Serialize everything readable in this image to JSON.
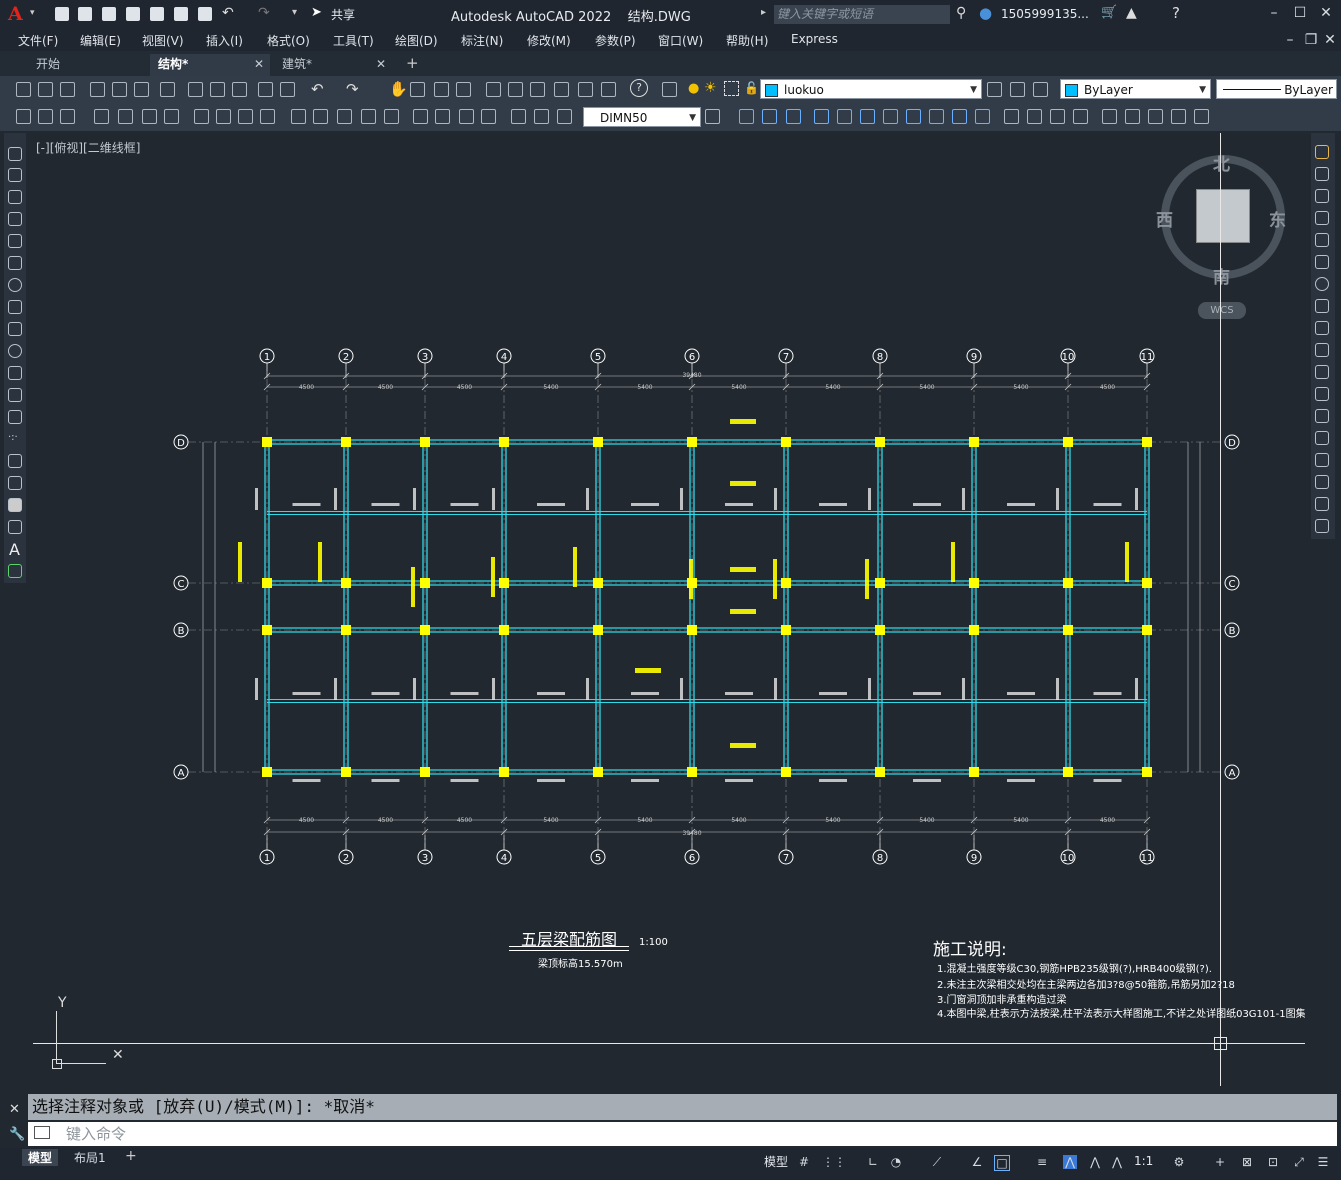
{
  "app": {
    "logo": "A",
    "title": "Autodesk AutoCAD 2022",
    "file": "结构.DWG",
    "search_placeholder": "键入关键字或短语",
    "user": "1505999135...",
    "share_label": "共享"
  },
  "menu": [
    "文件(F)",
    "编辑(E)",
    "视图(V)",
    "插入(I)",
    "格式(O)",
    "工具(T)",
    "绘图(D)",
    "标注(N)",
    "修改(M)",
    "参数(P)",
    "窗口(W)",
    "帮助(H)",
    "Express"
  ],
  "tabs": [
    {
      "label": "开始"
    },
    {
      "label": "结构*"
    },
    {
      "label": "建筑*"
    }
  ],
  "toolbar": {
    "layer_value": "luokuo",
    "color_value": "ByLayer",
    "linetype_value": "ByLayer",
    "dimstyle_value": "DIMN50"
  },
  "viewport": {
    "label": "[-][俯视][二维线框]",
    "viewcube": {
      "north": "北",
      "south": "南",
      "east": "东",
      "west": "西",
      "wcs": "WCS"
    }
  },
  "drawing": {
    "title": "五层梁配筋图",
    "scale": "1:100",
    "subtitle": "梁顶标高15.570m",
    "axes_top": [
      "1",
      "2",
      "3",
      "4",
      "5",
      "6",
      "7",
      "8",
      "9",
      "10",
      "11"
    ],
    "axes_left": [
      "D",
      "C",
      "B",
      "A"
    ],
    "spans": [
      "4500",
      "4500",
      "4500",
      "5400",
      "5400",
      "5400",
      "5400",
      "5400",
      "5400",
      "4500"
    ],
    "total": "39480",
    "notes_title": "施工说明:",
    "notes": [
      "1.混凝土强度等级C30,钢筋HPB235级钢(?),HRB400级钢(?).",
      "2.未注主次梁相交处均在主梁两边各加3?8@50箍筋,吊筋另加2?18",
      "3.门窗洞顶加非承重构造过梁",
      "4.本图中梁,柱表示方法按梁,柱平法表示大样图施工,不详之处详图纸03G101-1图集"
    ]
  },
  "command": {
    "history": "选择注释对象或 [放弃(U)/模式(M)]: *取消*",
    "placeholder": "键入命令"
  },
  "status": {
    "layouts": [
      "模型",
      "布局1"
    ],
    "model_label": "模型",
    "scale": "1:1"
  }
}
